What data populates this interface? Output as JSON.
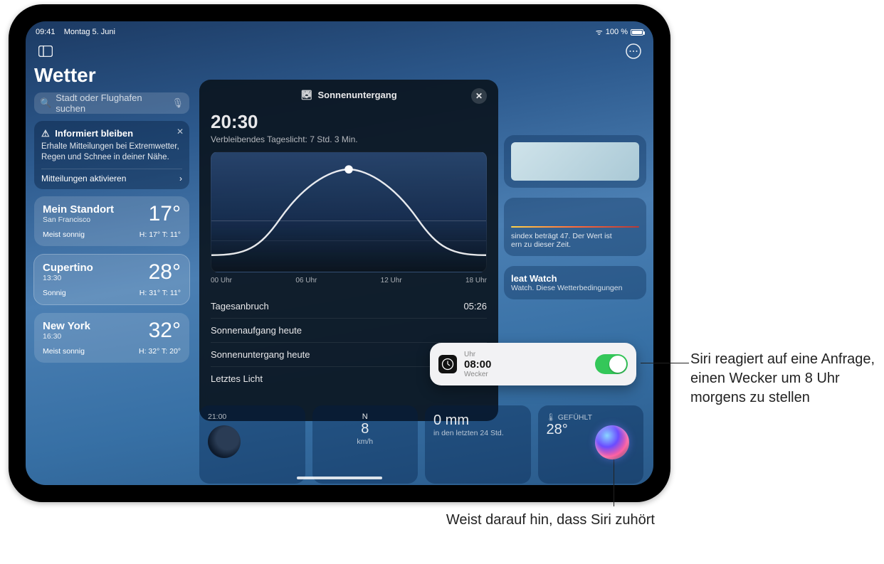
{
  "statusbar": {
    "time": "09:41",
    "date": "Montag 5. Juni",
    "battery_pct": "100 %"
  },
  "header": {
    "title": "Wetter"
  },
  "search": {
    "placeholder": "Stadt oder Flughafen suchen"
  },
  "info_card": {
    "title": "Informiert bleiben",
    "body": "Erhalte Mitteilungen bei Extremwetter, Regen und Schnee in deiner Nähe.",
    "action": "Mitteilungen aktivieren"
  },
  "locations": [
    {
      "name": "Mein Standort",
      "sub": "San Francisco",
      "temp": "17°",
      "cond": "Meist sonnig",
      "hilo": "H: 17° T: 11°"
    },
    {
      "name": "Cupertino",
      "sub": "13:30",
      "temp": "28°",
      "cond": "Sonnig",
      "hilo": "H: 31° T: 11°"
    },
    {
      "name": "New York",
      "sub": "16:30",
      "temp": "32°",
      "cond": "Meist sonnig",
      "hilo": "H: 32° T: 20°"
    }
  ],
  "modal": {
    "title": "Sonnenuntergang",
    "time": "20:30",
    "sub": "Verbleibendes Tageslicht: 7 Std. 3 Min.",
    "ticks": [
      "00 Uhr",
      "06 Uhr",
      "12 Uhr",
      "18 Uhr"
    ],
    "rows": [
      {
        "label": "Tagesanbruch",
        "value": "05:26"
      },
      {
        "label": "Sonnenaufgang heute",
        "value": ""
      },
      {
        "label": "Sonnenuntergang heute",
        "value": ""
      },
      {
        "label": "Letztes Licht",
        "value": ""
      }
    ]
  },
  "right_peek": {
    "uv_text": "sindex beträgt 47. Der Wert ist\nern zu dieser Zeit.",
    "heat_title": "leat Watch",
    "heat_sub": "Watch. Diese Wetterbedingungen"
  },
  "widgets": {
    "moon_time": "21:00",
    "wind_n": "N",
    "wind_speed": "8",
    "wind_unit": "km/h",
    "rain_val": "0 mm",
    "rain_sub": "in den letzten 24 Std.",
    "feels_label": "GEFÜHLT",
    "feels_val": "28°"
  },
  "siri_notif": {
    "app": "Uhr",
    "time": "08:00",
    "label": "Wecker"
  },
  "callouts": {
    "c1": "Siri reagiert auf eine Anfrage, einen Wecker um 8 Uhr morgens zu stellen",
    "c2": "Weist darauf hin, dass Siri zuhört"
  },
  "chart_data": {
    "type": "line",
    "title": "Sonnenuntergang",
    "xlabel": "",
    "ylabel": "",
    "x_tick_labels": [
      "00 Uhr",
      "06 Uhr",
      "12 Uhr",
      "18 Uhr"
    ],
    "x": [
      0,
      3,
      6,
      9,
      12,
      15,
      18,
      21,
      24
    ],
    "values": [
      -0.9,
      -0.6,
      0.1,
      0.75,
      1.0,
      0.75,
      0.1,
      -0.6,
      -0.9
    ],
    "ylim": [
      -1,
      1
    ],
    "marker_x": 12,
    "horizon": 0
  }
}
